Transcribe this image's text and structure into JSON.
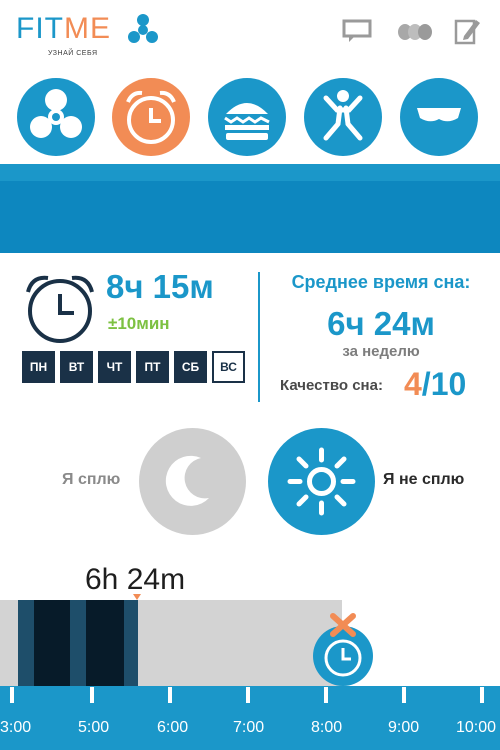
{
  "app": {
    "logo_fit": "FIT",
    "logo_me": "ME",
    "tagline": "УЗНАЙ СЕБЯ"
  },
  "header_icons": [
    "chat-icon",
    "pills-icon",
    "edit-icon"
  ],
  "categories": [
    {
      "name": "activity",
      "icon": "fan-icon",
      "active": false
    },
    {
      "name": "sleep",
      "icon": "alarm-clock-icon",
      "active": true
    },
    {
      "name": "food",
      "icon": "burger-icon",
      "active": false
    },
    {
      "name": "exercise",
      "icon": "person-jump-icon",
      "active": false
    },
    {
      "name": "rest",
      "icon": "sleep-mask-icon",
      "active": false
    }
  ],
  "alarm": {
    "time": "8ч 15м",
    "tolerance": "±10мин",
    "days": [
      {
        "label": "ПН",
        "on": true
      },
      {
        "label": "ВТ",
        "on": true
      },
      {
        "label": "ЧТ",
        "on": true
      },
      {
        "label": "ПТ",
        "on": true
      },
      {
        "label": "СБ",
        "on": true
      },
      {
        "label": "ВС",
        "on": false
      }
    ]
  },
  "stats": {
    "title": "Среднее время сна:",
    "value": "6ч 24м",
    "subtitle": "за неделю",
    "quality_label": "Качество сна:",
    "quality_value": "4",
    "quality_max": "/10"
  },
  "toggles": {
    "sleep_label": "Я сплю",
    "awake_label": "Я не сплю"
  },
  "timeline": {
    "duration": "6h 24m",
    "ticks": [
      "3:00",
      "5:00",
      "6:00",
      "7:00",
      "8:00",
      "9:00",
      "10:00"
    ]
  },
  "colors": {
    "primary": "#1b97c9",
    "accent": "#f28c55",
    "dark": "#1a3147",
    "green": "#7dc142"
  }
}
